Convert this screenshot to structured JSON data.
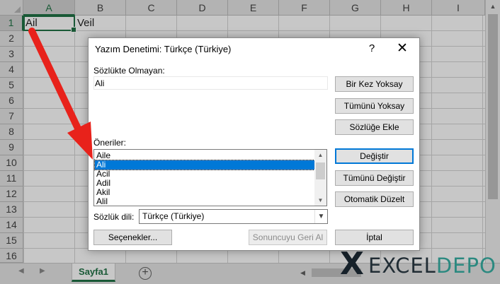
{
  "spreadsheet": {
    "columns": [
      "A",
      "B",
      "C",
      "D",
      "E",
      "F",
      "G",
      "H",
      "I"
    ],
    "rows": [
      "1",
      "2",
      "3",
      "4",
      "5",
      "6",
      "7",
      "8",
      "9",
      "10",
      "11",
      "12",
      "13",
      "14",
      "15",
      "16"
    ],
    "cells": {
      "A1": "Ail",
      "B1": "Veil"
    },
    "sheet_tab": "Sayfa1",
    "add_sheet": "+"
  },
  "dialog": {
    "title": "Yazım Denetimi: Türkçe (Türkiye)",
    "help": "?",
    "close": "✕",
    "not_in_dictionary_label": "Sözlükte Olmayan:",
    "not_in_dictionary_value": "Ali",
    "suggestions_label": "Öneriler:",
    "suggestions": [
      "Aile",
      "Ali",
      "Acil",
      "Adil",
      "Akil",
      "Alil"
    ],
    "selected_suggestion": "Ali",
    "dictionary_language_label": "Sözlük dili:",
    "dictionary_language": "Türkçe (Türkiye)",
    "buttons": {
      "ignore_once": "Bir Kez Yoksay",
      "ignore_all": "Tümünü Yoksay",
      "add_to_dictionary": "Sözlüğe Ekle",
      "change": "Değiştir",
      "change_all": "Tümünü Değiştir",
      "autocorrect": "Otomatik Düzelt",
      "options": "Seçenekler...",
      "undo_last": "Sonuncuyu Geri Al",
      "cancel": "İptal"
    }
  },
  "watermark": {
    "part1": "EXCEL",
    "part2": "DEPO"
  },
  "colors": {
    "excel_green": "#217346",
    "accent_blue": "#0078d7",
    "annotation_arrow": "#e8221b"
  }
}
